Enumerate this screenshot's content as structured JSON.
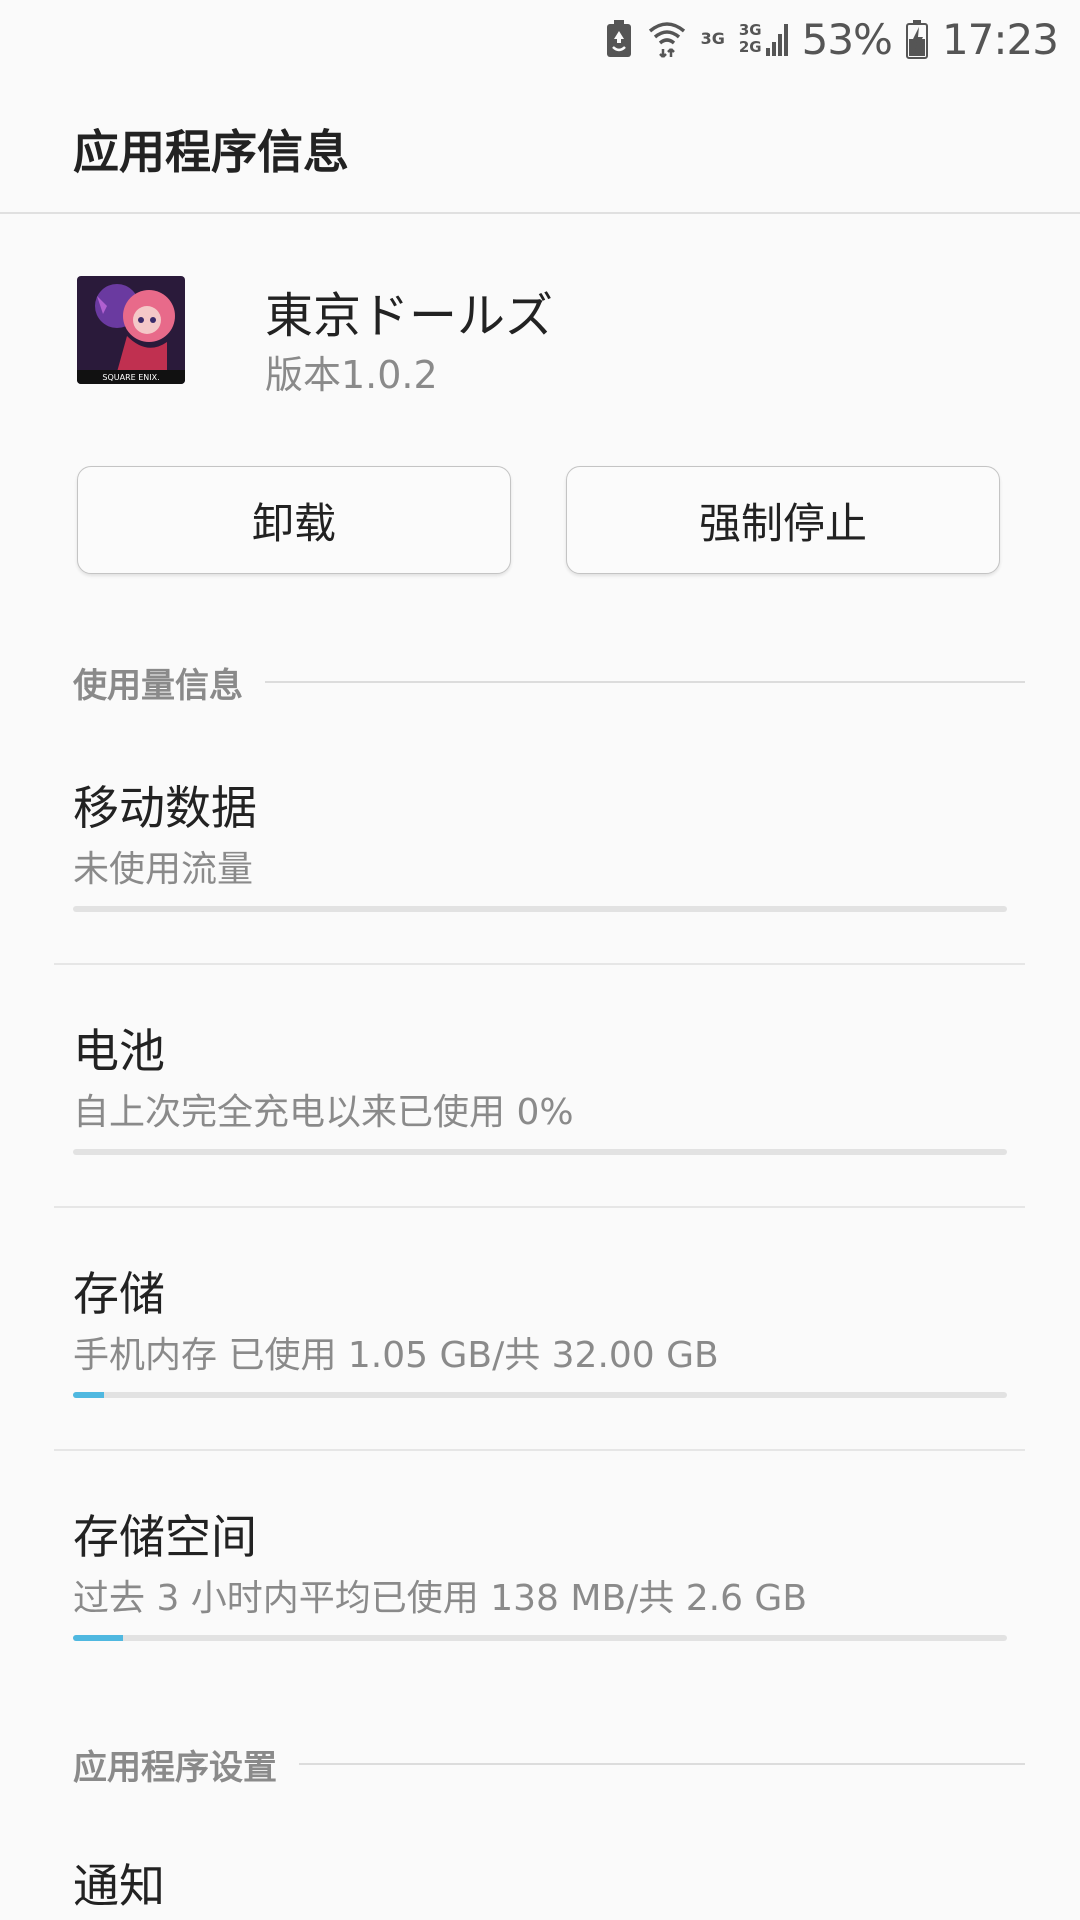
{
  "status_bar": {
    "icons": [
      "battery-saver-icon",
      "wifi-icon",
      "signal-3g-icon",
      "signal-3g-2g-icon",
      "charging-battery-icon"
    ],
    "net_label_1": "3G",
    "net_label_2a": "3G",
    "net_label_2b": "2G",
    "battery_percent": "53%",
    "time": "17:23"
  },
  "app_bar": {
    "title": "应用程序信息"
  },
  "app": {
    "name": "東京ドールズ",
    "version": "版本1.0.2",
    "icon_caption": "SQUARE ENIX."
  },
  "buttons": {
    "uninstall": "卸载",
    "force_stop": "强制停止"
  },
  "usage_section": {
    "header": "使用量信息",
    "items": [
      {
        "title": "移动数据",
        "subtitle": "未使用流量",
        "progress": 0
      },
      {
        "title": "电池",
        "subtitle": "自上次完全充电以来已使用 0%",
        "progress": 0
      },
      {
        "title": "存储",
        "subtitle": "手机内存 已使用 1.05 GB/共 32.00 GB",
        "progress": 0.033
      },
      {
        "title": "存储空间",
        "subtitle": "过去 3 小时内平均已使用 138 MB/共 2.6 GB",
        "progress": 0.053
      }
    ]
  },
  "settings_section": {
    "header": "应用程序设置",
    "items": [
      {
        "title": "通知"
      }
    ]
  },
  "colors": {
    "accent": "#4fb8e0",
    "background": "#fafafa"
  }
}
